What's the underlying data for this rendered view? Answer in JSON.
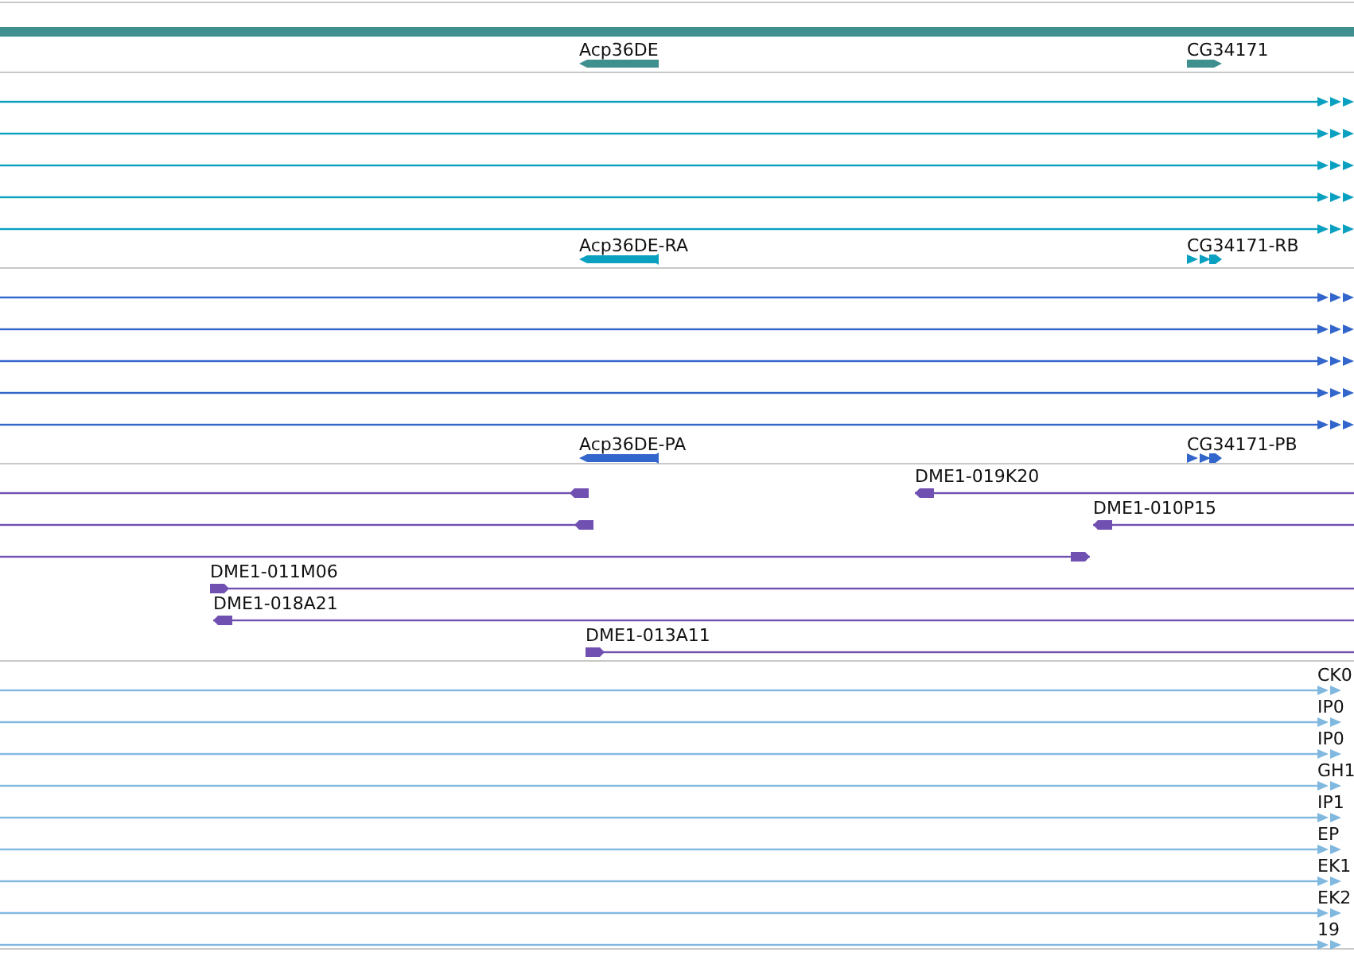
{
  "tracks": [
    {
      "kind": "gene",
      "color": "#3f8f8f",
      "features": [
        {
          "kind": "span"
        },
        {
          "kind": "model",
          "label": "Acp36DE",
          "reverse": true
        },
        {
          "kind": "model",
          "label": "CG34171",
          "reverse": false
        }
      ]
    },
    {
      "kind": "transcript",
      "color": "#0aa0c0",
      "features": [
        {
          "reverse": false
        },
        {
          "reverse": false
        },
        {
          "reverse": false
        },
        {
          "reverse": false
        },
        {
          "reverse": false
        },
        {
          "label": "Acp36DE-RA",
          "reverse": true
        },
        {
          "label": "CG34171-RB",
          "reverse": false
        }
      ]
    },
    {
      "kind": "transcript",
      "color": "#3366cc",
      "features": [
        {
          "reverse": false
        },
        {
          "reverse": false
        },
        {
          "reverse": false
        },
        {
          "reverse": false
        },
        {
          "reverse": false
        },
        {
          "label": "Acp36DE-PA",
          "reverse": true
        },
        {
          "label": "CG34171-PB",
          "reverse": false
        }
      ]
    },
    {
      "kind": "clone",
      "color": "#7050b0",
      "features": [
        {
          "reverse": true
        },
        {
          "label": "DME1-019K20",
          "reverse": true
        },
        {
          "reverse": true
        },
        {
          "label": "DME1-010P15",
          "reverse": true
        },
        {
          "reverse": false
        },
        {
          "label": "DME1-011M06",
          "reverse": false
        },
        {
          "label": "DME1-018A21",
          "reverse": true
        },
        {
          "label": "DME1-013A11",
          "reverse": false
        }
      ]
    },
    {
      "kind": "est",
      "color": "#80b8e0",
      "features": [
        {
          "label": "CK0",
          "reverse": false
        },
        {
          "label": "IP0",
          "reverse": false
        },
        {
          "label": "IP0",
          "reverse": false
        },
        {
          "label": "GH1",
          "reverse": false
        },
        {
          "label": "IP1",
          "reverse": false
        },
        {
          "label": "EP",
          "reverse": false
        },
        {
          "label": "EK1",
          "reverse": false
        },
        {
          "label": "EK2",
          "reverse": false
        },
        {
          "label": "19",
          "reverse": false
        }
      ]
    }
  ]
}
